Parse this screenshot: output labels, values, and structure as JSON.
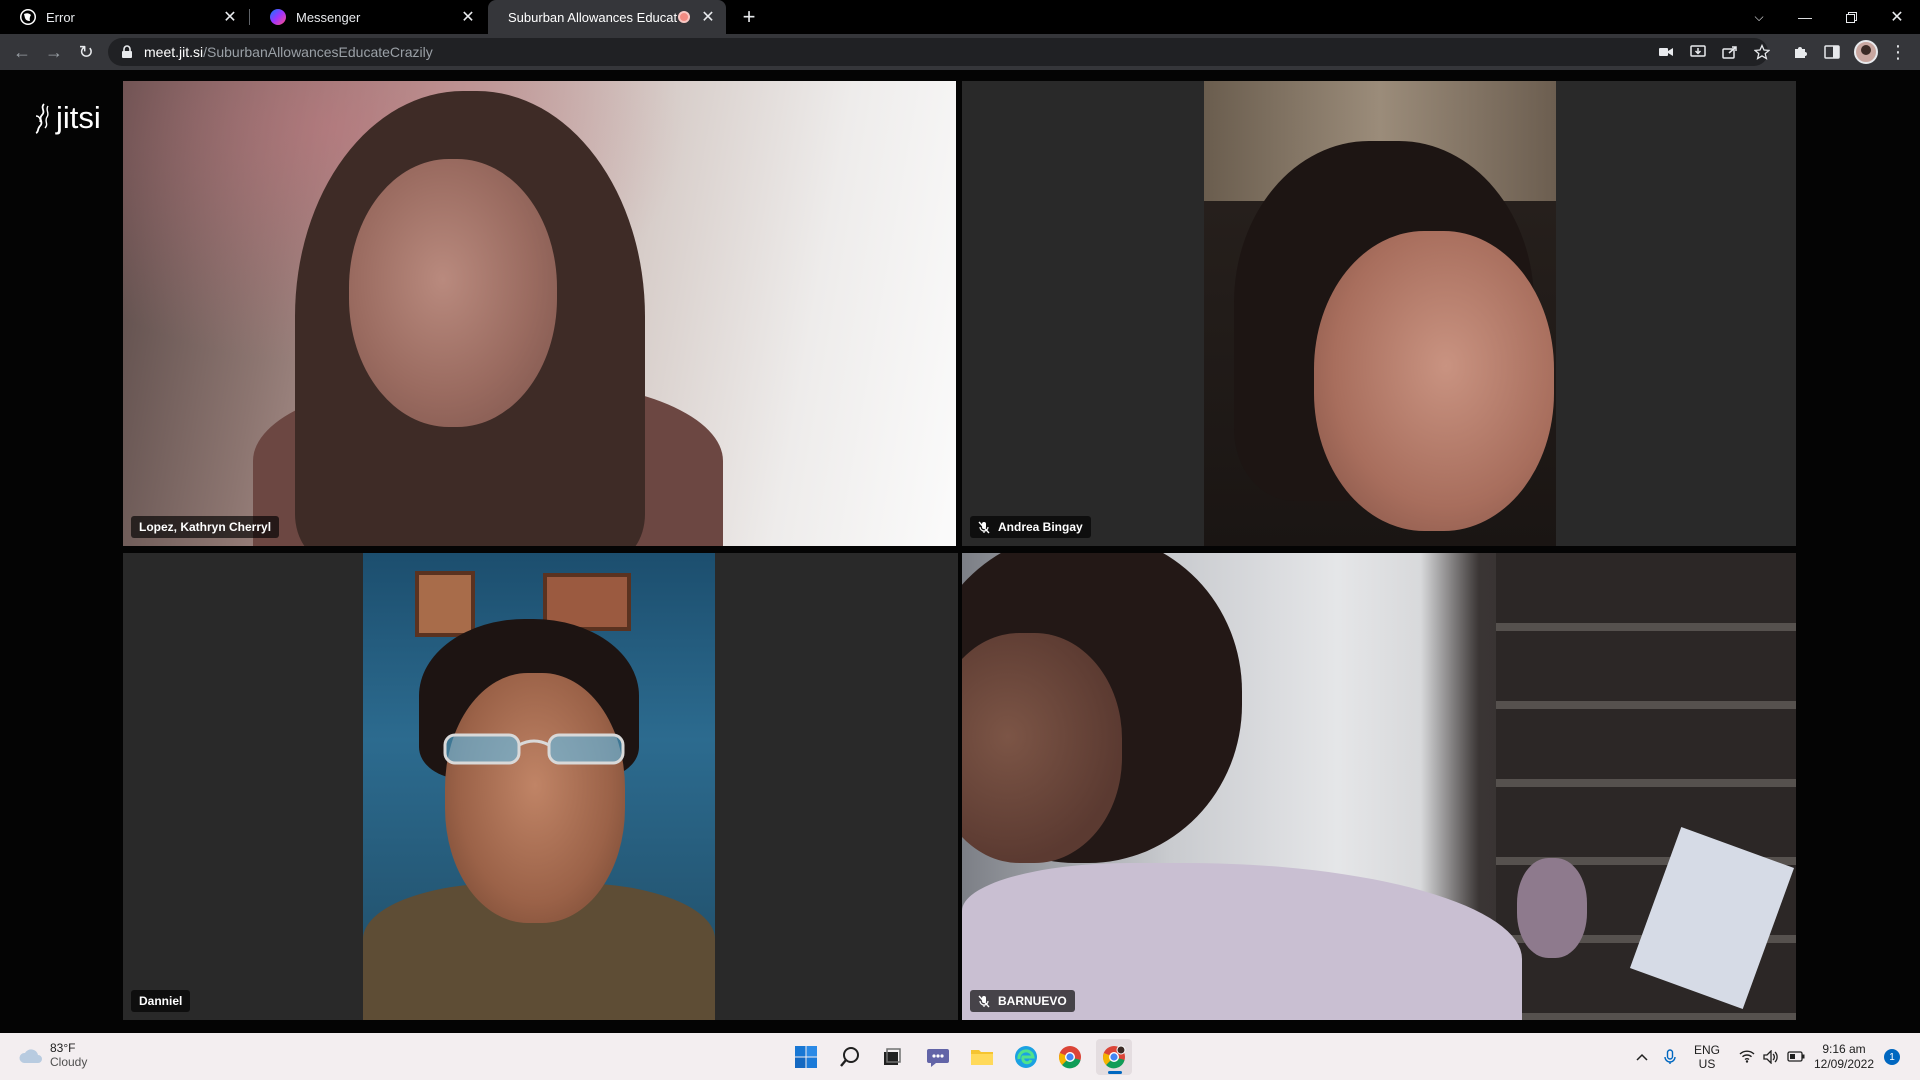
{
  "browser": {
    "tabs": [
      {
        "title": "Error",
        "active": false
      },
      {
        "title": "Messenger",
        "active": false
      },
      {
        "title": "Suburban Allowances Educat",
        "active": true,
        "recording": true
      }
    ],
    "address": {
      "host": "meet.jit.si",
      "path": "/SuburbanAllowancesEducateCrazily"
    }
  },
  "meeting": {
    "logo_text": "jitsi",
    "participants": [
      {
        "name": "Lopez, Kathryn Cherryl",
        "muted": false,
        "dominant_speaker": true
      },
      {
        "name": "Andrea Bingay",
        "muted": true,
        "dominant_speaker": false
      },
      {
        "name": "Danniel",
        "muted": false,
        "dominant_speaker": false
      },
      {
        "name": "BARNUEVO",
        "muted": true,
        "dominant_speaker": false
      }
    ],
    "accent_color": "#246fe5"
  },
  "taskbar": {
    "weather": {
      "temp": "83°F",
      "condition": "Cloudy"
    },
    "apps": [
      "windows-start",
      "search",
      "task-view",
      "teams-chat",
      "file-explorer",
      "edge",
      "chrome",
      "chrome-active"
    ],
    "lang": {
      "line1": "ENG",
      "line2": "US"
    },
    "clock": {
      "time": "9:16 am",
      "date": "12/09/2022"
    },
    "notification_count": "1"
  }
}
